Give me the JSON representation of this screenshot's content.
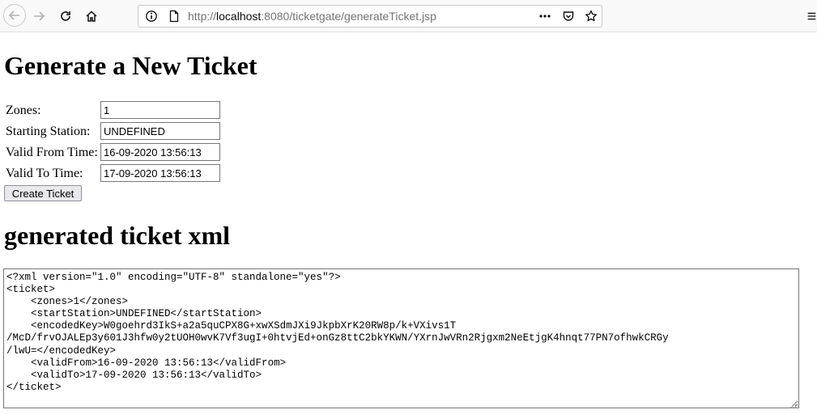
{
  "browser": {
    "url_prefix": "http://",
    "url_host": "localhost",
    "url_rest": ":8080/ticketgate/generateTicket.jsp",
    "icons": {
      "back": "back-arrow-icon",
      "forward": "forward-arrow-icon",
      "reload": "reload-icon",
      "home": "home-icon",
      "info": "site-info-icon",
      "page": "page-icon",
      "more": "more-actions-icon",
      "pocket": "pocket-icon",
      "bookmark": "bookmark-star-icon",
      "menu": "hamburger-menu-icon"
    }
  },
  "page": {
    "heading": "Generate a New Ticket",
    "form": {
      "zones_label": "Zones:",
      "zones_value": "1",
      "station_label": "Starting Station:",
      "station_value": "UNDEFINED",
      "from_label": "Valid From Time:",
      "from_value": "16-09-2020 13:56:13",
      "to_label": "Valid To Time:",
      "to_value": "17-09-2020 13:56:13",
      "submit_label": "Create Ticket"
    },
    "xml_heading": "generated ticket xml",
    "xml_content": "<?xml version=\"1.0\" encoding=\"UTF-8\" standalone=\"yes\"?>\n<ticket>\n    <zones>1</zones>\n    <startStation>UNDEFINED</startStation>\n    <encodedKey>W0goehrd3IkS+a2a5quCPX8G+xwXSdmJXi9JkpbXrK20RW8p/k+VXivs1T\n/McD/frvOJALEp3y601J3hfw0y2tUOH0wvK7Vf3ugI+0htvjEd+onGz8ttC2bkYKWN/YXrnJwVRn2Rjgxm2NeEtjgK4hnqt77PN7ofhwkCRGy\n/lwU=</encodedKey>\n    <validFrom>16-09-2020 13:56:13</validFrom>\n    <validTo>17-09-2020 13:56:13</validTo>\n</ticket>"
  }
}
